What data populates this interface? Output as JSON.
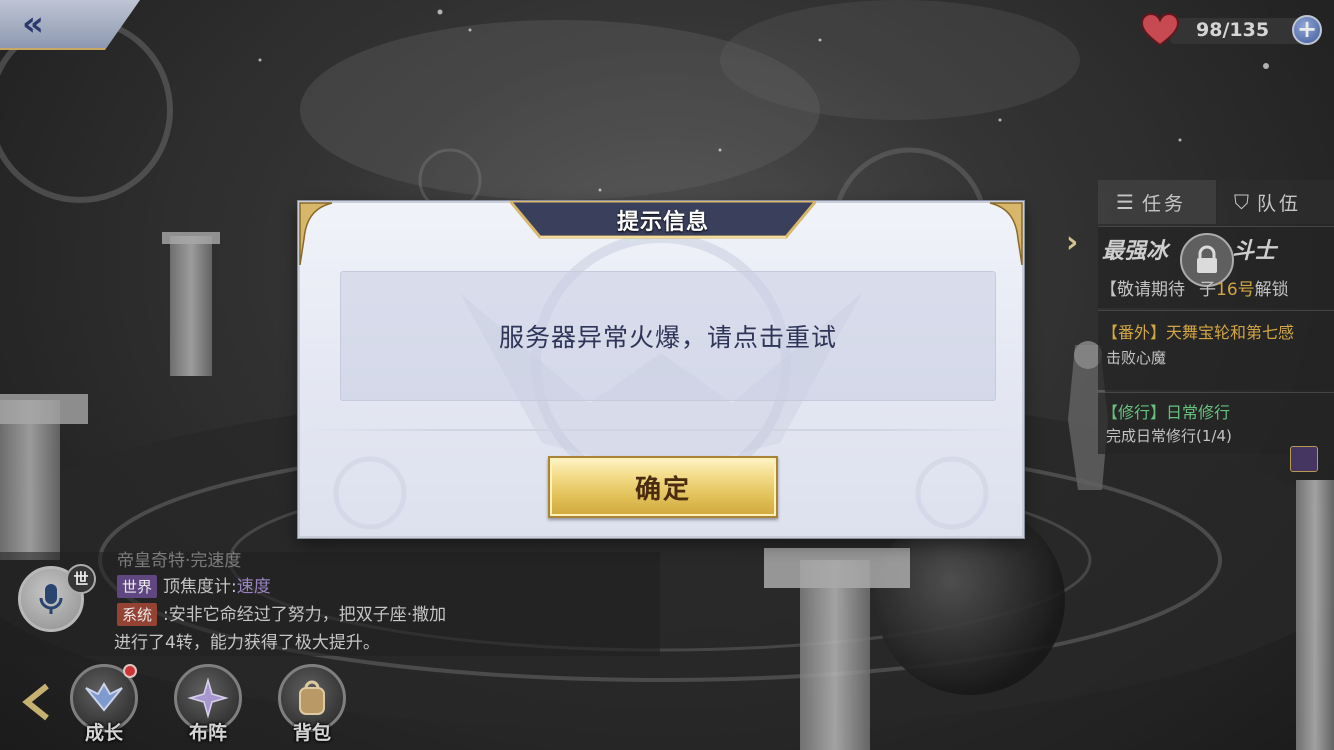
{
  "dialog": {
    "title": "提示信息",
    "message": "服务器异常火爆，请点击重试",
    "confirm_label": "确定"
  },
  "stamina": {
    "value": "98/135"
  },
  "quest_panel": {
    "tabs": [
      "任务",
      "队伍"
    ],
    "main": {
      "title_part1": "最强冰",
      "title_part2": "斗士",
      "desc_prefix": "【敬请期待",
      "desc_mid": "子",
      "desc_highlight": "16号",
      "desc_suffix": "解锁"
    },
    "side_quest": {
      "title": "【番外】天舞宝轮和第七感",
      "desc": "击败心魔"
    },
    "daily_quest": {
      "title": "【修行】日常修行",
      "desc": "完成日常修行(1/4)"
    }
  },
  "chat": {
    "world_badge": "世",
    "lines": [
      {
        "text": "帝皇奇特·完速度"
      },
      {
        "channel": "世界",
        "text": "顶焦度计:",
        "extra": "速度"
      },
      {
        "channel": "系统",
        "text": ":安非它命经过了努力，把双子座·撒加"
      },
      {
        "text": "进行了4转，能力获得了极大提升。"
      }
    ]
  },
  "bottom_menu": {
    "items": [
      {
        "label": "成长"
      },
      {
        "label": "布阵"
      },
      {
        "label": "背包"
      }
    ]
  },
  "colors": {
    "dialog_title_bar": "#3a3f5c",
    "gold_trim": "#d8b66a",
    "confirm_gold": "#e2c25a",
    "world_channel": "#6a4e8e",
    "system_channel": "#a04838",
    "notification_dot": "#e03b3b"
  }
}
